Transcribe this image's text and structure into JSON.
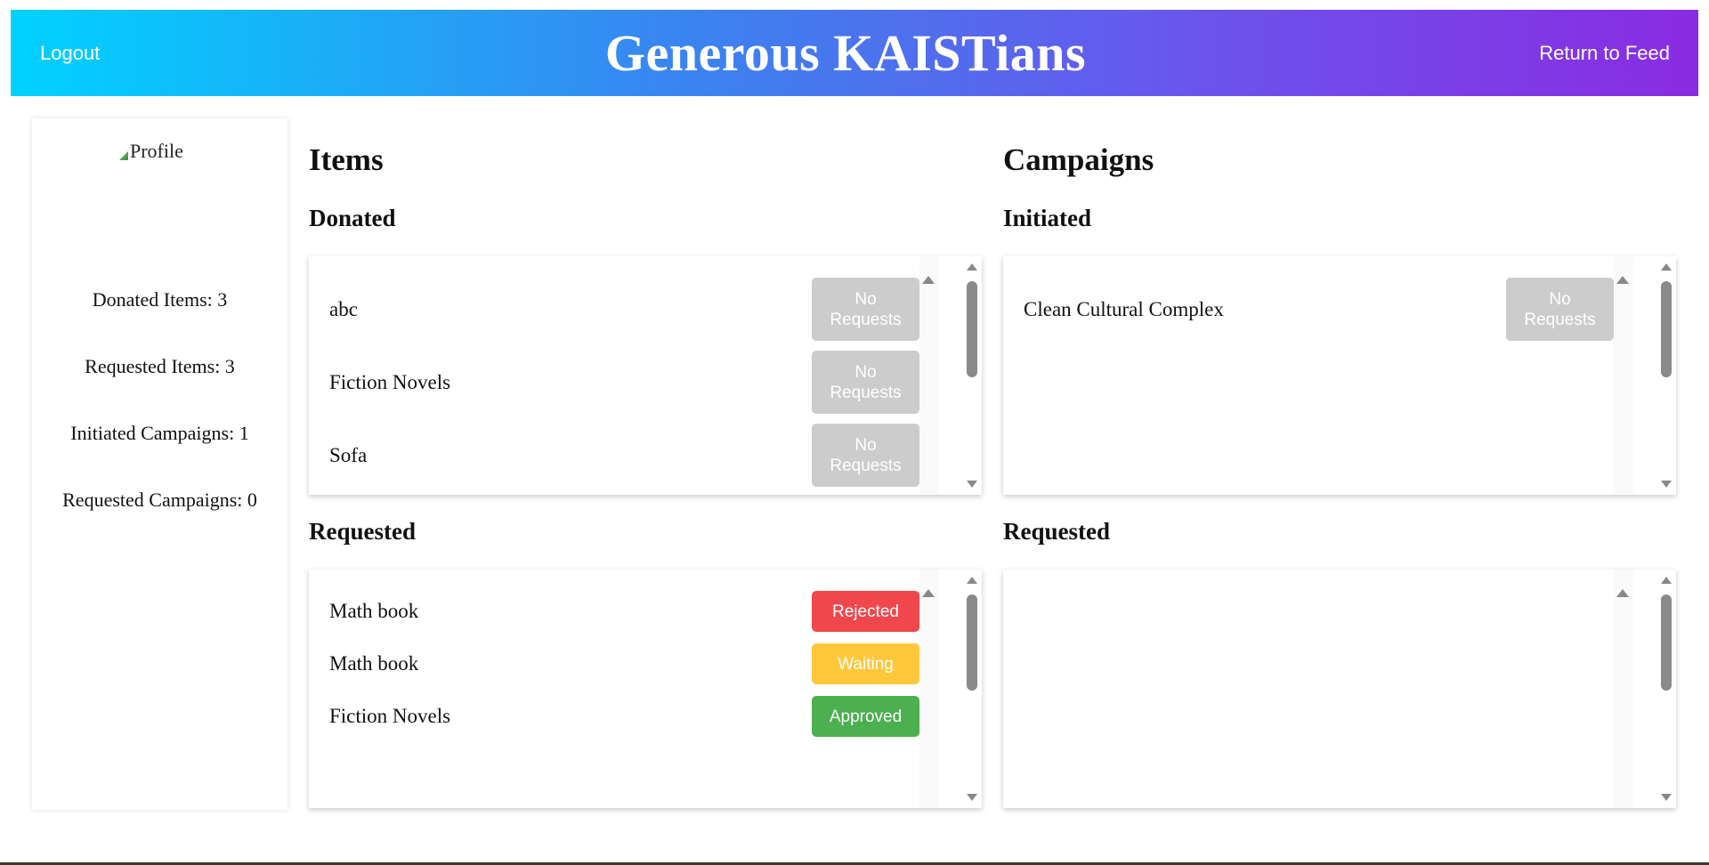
{
  "header": {
    "logout_label": "Logout",
    "title": "Generous KAISTians",
    "return_label": "Return to Feed",
    "gradient": [
      "#00d2ff",
      "#8a2be2"
    ]
  },
  "profile": {
    "image_alt": "Profile",
    "stats": {
      "donated_items": "Donated Items: 3",
      "requested_items": "Requested Items: 3",
      "initiated_campaigns": "Initiated Campaigns: 1",
      "requested_campaigns": "Requested Campaigns: 0"
    }
  },
  "items": {
    "heading": "Items",
    "donated": {
      "heading": "Donated",
      "rows": [
        {
          "name": "abc",
          "status": "No Requests"
        },
        {
          "name": "Fiction Novels",
          "status": "No Requests"
        },
        {
          "name": "Sofa",
          "status": "No Requests"
        }
      ]
    },
    "requested": {
      "heading": "Requested",
      "rows": [
        {
          "name": "Math book",
          "status": "Rejected"
        },
        {
          "name": "Math book",
          "status": "Waiting"
        },
        {
          "name": "Fiction Novels",
          "status": "Approved"
        }
      ]
    }
  },
  "campaigns": {
    "heading": "Campaigns",
    "initiated": {
      "heading": "Initiated",
      "rows": [
        {
          "name": "Clean Cultural Complex",
          "status": "No Requests"
        }
      ]
    },
    "requested": {
      "heading": "Requested",
      "rows": []
    }
  },
  "status_colors": {
    "none": "#cccccc",
    "rejected": "#f0474c",
    "waiting": "#ffc73a",
    "approved": "#4caf50"
  }
}
